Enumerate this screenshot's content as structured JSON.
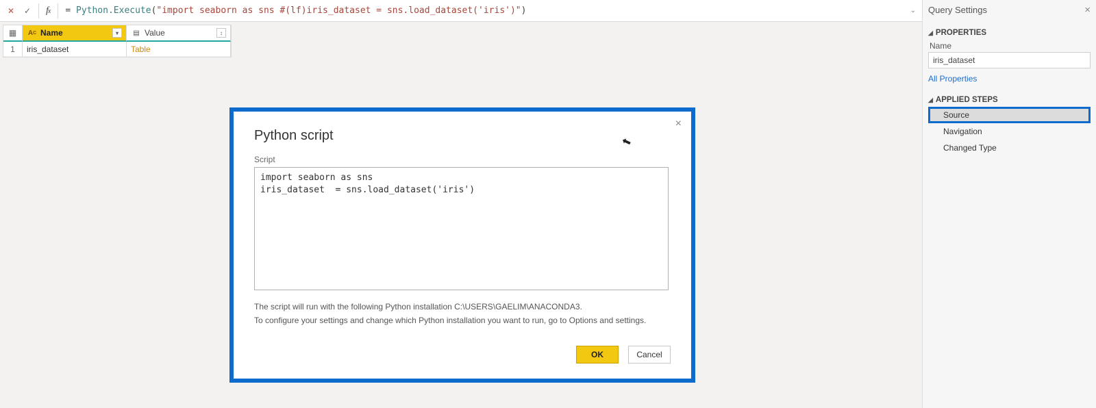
{
  "formula_bar": {
    "eq": "=",
    "fn": "Python.Execute",
    "open": "(",
    "quote1": "\"",
    "str": "import seaborn as sns #(lf)iris_dataset  = sns.load_dataset('iris')",
    "quote2": "\"",
    "close": ")"
  },
  "grid": {
    "columns": {
      "name": "Name",
      "value": "Value"
    },
    "rows": [
      {
        "idx": "1",
        "name": "iris_dataset",
        "value": "Table"
      }
    ]
  },
  "dialog": {
    "title": "Python script",
    "script_label": "Script",
    "script_text": "import seaborn as sns\niris_dataset  = sns.load_dataset('iris')",
    "info1": "The script will run with the following Python installation C:\\USERS\\GAELIM\\ANACONDA3.",
    "info2": "To configure your settings and change which Python installation you want to run, go to Options and settings.",
    "ok": "OK",
    "cancel": "Cancel"
  },
  "side": {
    "panel_title": "Query Settings",
    "properties_title": "PROPERTIES",
    "name_label": "Name",
    "name_value": "iris_dataset",
    "all_properties": "All Properties",
    "steps_title": "APPLIED STEPS",
    "steps": [
      {
        "label": "Source",
        "highlight": true
      },
      {
        "label": "Navigation",
        "highlight": false
      },
      {
        "label": "Changed Type",
        "highlight": false
      }
    ]
  }
}
